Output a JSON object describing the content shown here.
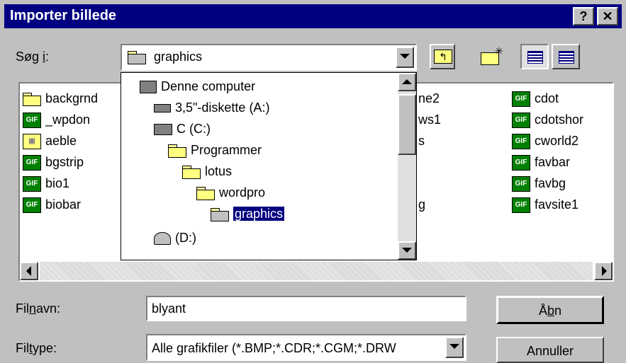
{
  "window": {
    "title": "Importer billede",
    "help_label": "?",
    "close_label": "✕"
  },
  "lookin": {
    "label_pre": "Søg ",
    "label_acc": "i",
    "label_post": ":",
    "value": "graphics"
  },
  "dropdown": {
    "items": [
      {
        "label": "Denne computer",
        "icon": "computer-icon"
      },
      {
        "label": "3,5\"-diskette (A:)",
        "icon": "floppy-icon"
      },
      {
        "label": "C (C:)",
        "icon": "harddrive-icon"
      },
      {
        "label": "Programmer",
        "icon": "folder-icon"
      },
      {
        "label": "lotus",
        "icon": "folder-icon"
      },
      {
        "label": "wordpro",
        "icon": "folder-icon"
      },
      {
        "label": "graphics",
        "icon": "open-folder-icon",
        "selected": true
      },
      {
        "label": "(D:)",
        "icon": "cdrom-icon"
      }
    ]
  },
  "files": {
    "col1": [
      {
        "label": "backgrnd",
        "type": "folder"
      },
      {
        "label": "_wpdon",
        "type": "gif"
      },
      {
        "label": "aeble",
        "type": "image"
      },
      {
        "label": "bgstrip",
        "type": "gif"
      },
      {
        "label": "bio1",
        "type": "gif"
      },
      {
        "label": "biobar",
        "type": "gif"
      }
    ],
    "col3_partial": [
      "ne2",
      "ws1",
      "s",
      "",
      "g",
      ""
    ],
    "col4": [
      {
        "label": "cdot",
        "type": "gif"
      },
      {
        "label": "cdotshor",
        "type": "gif"
      },
      {
        "label": "cworld2",
        "type": "gif"
      },
      {
        "label": "favbar",
        "type": "gif"
      },
      {
        "label": "favbg",
        "type": "gif"
      },
      {
        "label": "favsite1",
        "type": "gif"
      }
    ]
  },
  "filename": {
    "label_pre": "Fil",
    "label_acc": "n",
    "label_post": "avn:",
    "value": "blyant"
  },
  "filetype": {
    "label_pre": "Fil",
    "label_acc": "t",
    "label_post": "ype:",
    "value": "Alle grafikfiler (*.BMP;*.CDR;*.CGM;*.DRW"
  },
  "buttons": {
    "open_pre": "Å",
    "open_acc": "b",
    "open_post": "n",
    "cancel": "Annuller"
  },
  "icons": {
    "gif_text": "GIF"
  }
}
